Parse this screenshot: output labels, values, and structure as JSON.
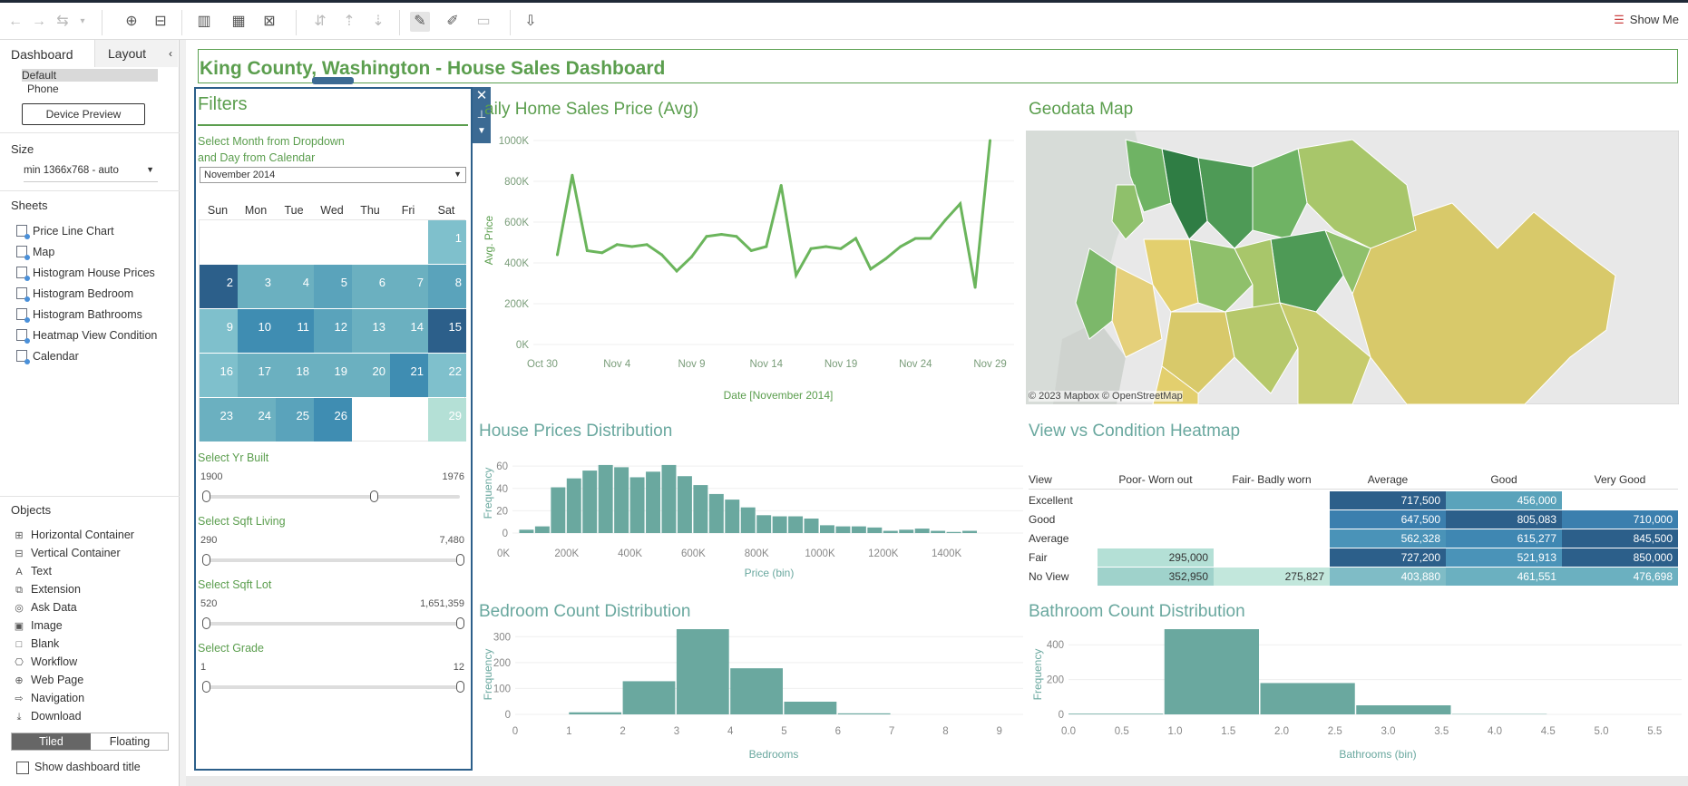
{
  "toolbar": {
    "show_me": "Show Me"
  },
  "left_pane": {
    "tabs": [
      "Dashboard",
      "Layout"
    ],
    "device": {
      "default": "Default",
      "phone": "Phone",
      "preview_button": "Device Preview"
    },
    "size": {
      "heading": "Size",
      "value": "min 1366x768 - auto"
    },
    "sheets": {
      "heading": "Sheets",
      "items": [
        "Price Line Chart",
        "Map",
        "Histogram House Prices",
        "Histogram Bedroom",
        "Histogram Bathrooms",
        "Heatmap View Condition",
        "Calendar"
      ]
    },
    "objects": {
      "heading": "Objects",
      "items": [
        {
          "label": "Horizontal Container",
          "icon": "horizontal-container-icon"
        },
        {
          "label": "Vertical Container",
          "icon": "vertical-container-icon"
        },
        {
          "label": "Text",
          "icon": "text-icon"
        },
        {
          "label": "Extension",
          "icon": "extension-icon"
        },
        {
          "label": "Ask Data",
          "icon": "ask-data-icon"
        },
        {
          "label": "Image",
          "icon": "image-icon"
        },
        {
          "label": "Blank",
          "icon": "blank-icon"
        },
        {
          "label": "Workflow",
          "icon": "workflow-icon"
        },
        {
          "label": "Web Page",
          "icon": "web-page-icon"
        },
        {
          "label": "Navigation",
          "icon": "navigation-icon"
        },
        {
          "label": "Download",
          "icon": "download-icon"
        }
      ]
    },
    "tiled": "Tiled",
    "floating": "Floating",
    "show_title": "Show dashboard title"
  },
  "dashboard": {
    "title": "King County, Washington - House Sales Dashboard",
    "filters": {
      "heading": "Filters",
      "month_label_1": "Select Month from Dropdown",
      "month_label_2": "and Day from Calendar",
      "month_value": "November 2014",
      "days": [
        "Sun",
        "Mon",
        "Tue",
        "Wed",
        "Thu",
        "Fri",
        "Sat"
      ],
      "yr_built": {
        "label": "Select Yr Built",
        "min": "1900",
        "max": "1976",
        "lo": 0.0,
        "hi": 0.66
      },
      "sqft_living": {
        "label": "Select Sqft Living",
        "min": "290",
        "max": "7,480",
        "lo": 0.0,
        "hi": 1.0
      },
      "sqft_lot": {
        "label": "Select Sqft Lot",
        "min": "520",
        "max": "1,651,359",
        "lo": 0.0,
        "hi": 1.0
      },
      "grade": {
        "label": "Select Grade",
        "min": "1",
        "max": "12",
        "lo": 0.0,
        "hi": 1.0
      }
    },
    "calendar": {
      "cells": [
        {
          "d": "1",
          "c": "#7fc0cc"
        },
        {
          "d": "2",
          "c": "#2c5f8a"
        },
        {
          "d": "3",
          "c": "#6bb0c0"
        },
        {
          "d": "4",
          "c": "#6bb0c0"
        },
        {
          "d": "5",
          "c": "#5aa3bb"
        },
        {
          "d": "6",
          "c": "#6bb0c0"
        },
        {
          "d": "7",
          "c": "#6bb0c0"
        },
        {
          "d": "8",
          "c": "#5aa3bb"
        },
        {
          "d": "9",
          "c": "#7fc0cc"
        },
        {
          "d": "10",
          "c": "#3f8db2"
        },
        {
          "d": "11",
          "c": "#3f8db2"
        },
        {
          "d": "12",
          "c": "#5aa3bb"
        },
        {
          "d": "13",
          "c": "#6bb0c0"
        },
        {
          "d": "14",
          "c": "#6bb0c0"
        },
        {
          "d": "15",
          "c": "#2c5f8a"
        },
        {
          "d": "16",
          "c": "#7fc0cc"
        },
        {
          "d": "17",
          "c": "#6bb0c0"
        },
        {
          "d": "18",
          "c": "#6bb0c0"
        },
        {
          "d": "19",
          "c": "#6bb0c0"
        },
        {
          "d": "20",
          "c": "#6bb0c0"
        },
        {
          "d": "21",
          "c": "#3f8db2"
        },
        {
          "d": "22",
          "c": "#7fc0cc"
        },
        {
          "d": "23",
          "c": "#6bb0c0"
        },
        {
          "d": "24",
          "c": "#6bb0c0"
        },
        {
          "d": "25",
          "c": "#5aa3bb"
        },
        {
          "d": "26",
          "c": "#3f8db2"
        },
        {
          "d": "29",
          "c": "#b4e0d6"
        }
      ]
    },
    "line_title": "aily Home Sales Price (Avg)",
    "map_title": "Geodata Map",
    "map_attribution": "© 2023 Mapbox  © OpenStreetMap",
    "hist_price_title": "House Prices Distribution",
    "heatmap_title": "View vs Condition Heatmap",
    "bed_title": "Bedroom Count Distribution",
    "bath_title": "Bathroom Count Distribution",
    "colors": {
      "green": "#5b9e4e",
      "teal": "#6aa89f",
      "navy": "#2c5f8a"
    },
    "heatmap": {
      "corner": "View",
      "columns": [
        "Poor- Worn out",
        "Fair- Badly worn",
        "Average",
        "Good",
        "Very Good"
      ],
      "rows": [
        {
          "label": "Excellent",
          "cells": [
            "",
            "",
            "717,500",
            "456,000",
            ""
          ],
          "colors": [
            null,
            null,
            "#2c5f8a",
            "#5aa3bb",
            null
          ]
        },
        {
          "label": "Good",
          "cells": [
            "",
            "",
            "647,500",
            "805,083",
            "710,000"
          ],
          "colors": [
            null,
            null,
            "#3b7fae",
            "#2c5f8a",
            "#3b7fae"
          ]
        },
        {
          "label": "Average",
          "cells": [
            "",
            "",
            "562,328",
            "615,277",
            "845,500"
          ],
          "colors": [
            null,
            null,
            "#4a93b8",
            "#3f87b2",
            "#2c5f8a"
          ]
        },
        {
          "label": "Fair",
          "cells": [
            "295,000",
            "",
            "727,200",
            "521,913",
            "850,000"
          ],
          "colors": [
            "#b4e0d6",
            null,
            "#2c5f8a",
            "#4a93b8",
            "#2c5f8a"
          ]
        },
        {
          "label": "No View",
          "cells": [
            "352,950",
            "275,827",
            "403,880",
            "461,551",
            "476,698"
          ],
          "colors": [
            "#9fd2cb",
            "#c2e7dc",
            "#7fbcc6",
            "#6bb0c0",
            "#6bb0c0"
          ]
        }
      ]
    }
  },
  "chart_data": [
    {
      "type": "line",
      "title": "Daily Home Sales Price (Avg)",
      "xlabel": "Date [November 2014]",
      "ylabel": "Avg. Price",
      "x_ticks": [
        "Oct 30",
        "Nov 4",
        "Nov 9",
        "Nov 14",
        "Nov 19",
        "Nov 24",
        "Nov 29"
      ],
      "y_ticks": [
        "0K",
        "200K",
        "400K",
        "600K",
        "800K",
        "1000K"
      ],
      "ylim": [
        0,
        1000000
      ],
      "x": [
        "Oct 31",
        "Nov 1",
        "Nov 2",
        "Nov 3",
        "Nov 4",
        "Nov 5",
        "Nov 6",
        "Nov 7",
        "Nov 8",
        "Nov 9",
        "Nov 10",
        "Nov 11",
        "Nov 12",
        "Nov 13",
        "Nov 14",
        "Nov 15",
        "Nov 16",
        "Nov 17",
        "Nov 18",
        "Nov 19",
        "Nov 20",
        "Nov 21",
        "Nov 22",
        "Nov 23",
        "Nov 24",
        "Nov 25",
        "Nov 26",
        "Nov 27",
        "Nov 28",
        "Nov 29",
        "Nov 30"
      ],
      "values": [
        440000,
        830000,
        460000,
        450000,
        490000,
        480000,
        490000,
        440000,
        360000,
        430000,
        530000,
        540000,
        530000,
        460000,
        480000,
        780000,
        340000,
        470000,
        480000,
        470000,
        520000,
        370000,
        420000,
        480000,
        520000,
        520000,
        610000,
        690000,
        280000,
        1000000
      ]
    },
    {
      "type": "bar",
      "title": "House Prices Distribution",
      "xlabel": "Price (bin)",
      "ylabel": "Frequency",
      "x_ticks": [
        "0K",
        "200K",
        "400K",
        "600K",
        "800K",
        "1000K",
        "1200K",
        "1400K"
      ],
      "y_ticks": [
        "0",
        "20",
        "40",
        "60"
      ],
      "ylim": [
        0,
        65
      ],
      "bin_start": [
        50,
        100,
        150,
        200,
        250,
        300,
        350,
        400,
        450,
        500,
        550,
        600,
        650,
        700,
        750,
        800,
        850,
        900,
        950,
        1000,
        1050,
        1100,
        1150,
        1200,
        1250,
        1300,
        1350,
        1400,
        1450
      ],
      "values": [
        3,
        6,
        41,
        49,
        56,
        61,
        59,
        50,
        55,
        61,
        51,
        43,
        35,
        30,
        23,
        16,
        15,
        15,
        13,
        7,
        6,
        6,
        5,
        2,
        3,
        4,
        2,
        1,
        2
      ]
    },
    {
      "type": "bar",
      "title": "View vs Condition Heatmap",
      "xlabel": "",
      "ylabel": "",
      "x_ticks": [],
      "y_ticks": [],
      "values": []
    },
    {
      "type": "bar",
      "title": "Bedroom Count Distribution",
      "xlabel": "Bedrooms",
      "ylabel": "Frequency",
      "x_ticks": [
        "0",
        "1",
        "2",
        "3",
        "4",
        "5",
        "6",
        "7",
        "8",
        "9"
      ],
      "y_ticks": [
        "0",
        "100",
        "200",
        "300"
      ],
      "ylim": [
        0,
        350
      ],
      "categories": [
        "1",
        "2",
        "3",
        "4",
        "5",
        "6"
      ],
      "values": [
        8,
        128,
        335,
        178,
        49,
        4
      ]
    },
    {
      "type": "bar",
      "title": "Bathroom Count Distribution",
      "xlabel": "Bathrooms (bin)",
      "ylabel": "Frequency",
      "x_ticks": [
        "0.0",
        "0.5",
        "1.0",
        "1.5",
        "2.0",
        "2.5",
        "3.0",
        "3.5",
        "4.0",
        "4.5",
        "5.0",
        "5.5"
      ],
      "y_ticks": [
        "0",
        "200",
        "400"
      ],
      "ylim": [
        0,
        500
      ],
      "bin_start": [
        0.0,
        0.9,
        1.8,
        2.7,
        3.6
      ],
      "values": [
        4,
        490,
        180,
        52,
        2
      ]
    }
  ]
}
